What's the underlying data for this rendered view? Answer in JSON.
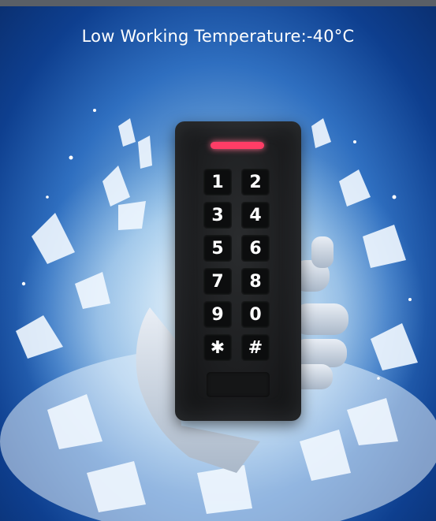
{
  "headline": "Low Working Temperature:-40°C",
  "keypad": {
    "keys": [
      "1",
      "2",
      "3",
      "4",
      "5",
      "6",
      "7",
      "8",
      "9",
      "0",
      "✱",
      "#"
    ]
  },
  "colors": {
    "background": "#0d3d86",
    "ice": "#d6ecfb",
    "device": "#1b1c1e",
    "indicator": "#ff3d66",
    "text": "#ffffff"
  }
}
